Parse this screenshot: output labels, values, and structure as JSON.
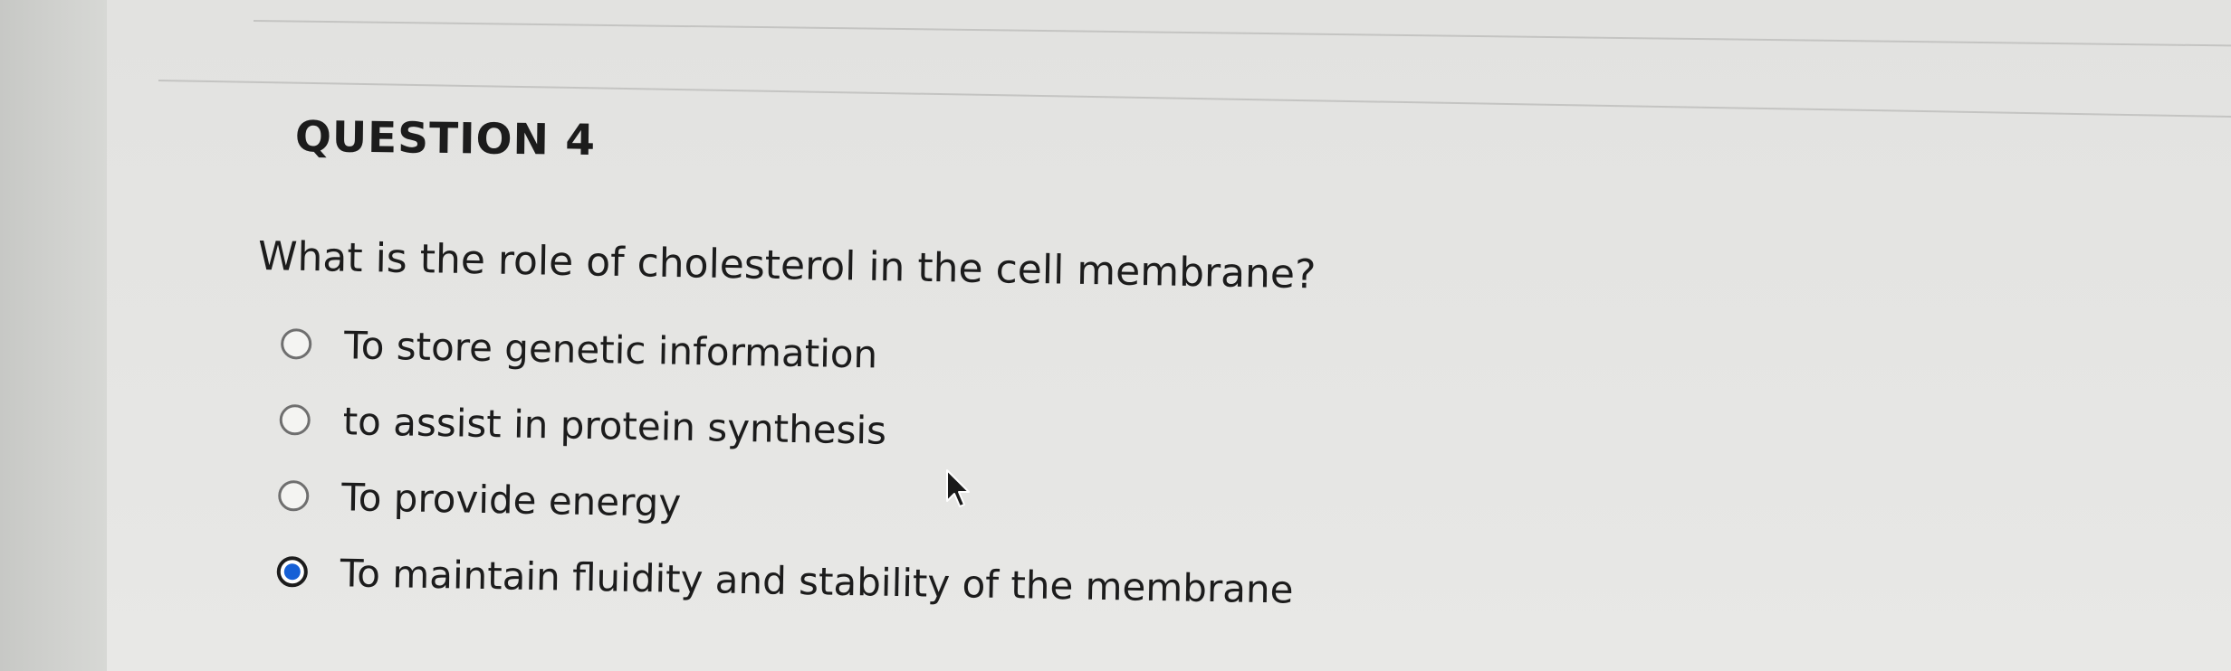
{
  "question": {
    "heading": "QUESTION 4",
    "prompt": "What is the role of cholesterol in the cell membrane?",
    "options": [
      {
        "label": "To store genetic information",
        "selected": false
      },
      {
        "label": "to assist in protein synthesis",
        "selected": false
      },
      {
        "label": "To provide energy",
        "selected": false
      },
      {
        "label": "To maintain fluidity and stability of the membrane",
        "selected": true
      }
    ]
  },
  "colors": {
    "selected_radio_fill": "#1660d6",
    "text": "#1c1c1c",
    "background": "#e6e6e4"
  },
  "icons": {
    "cursor": "mouse-pointer-arrow-icon"
  }
}
